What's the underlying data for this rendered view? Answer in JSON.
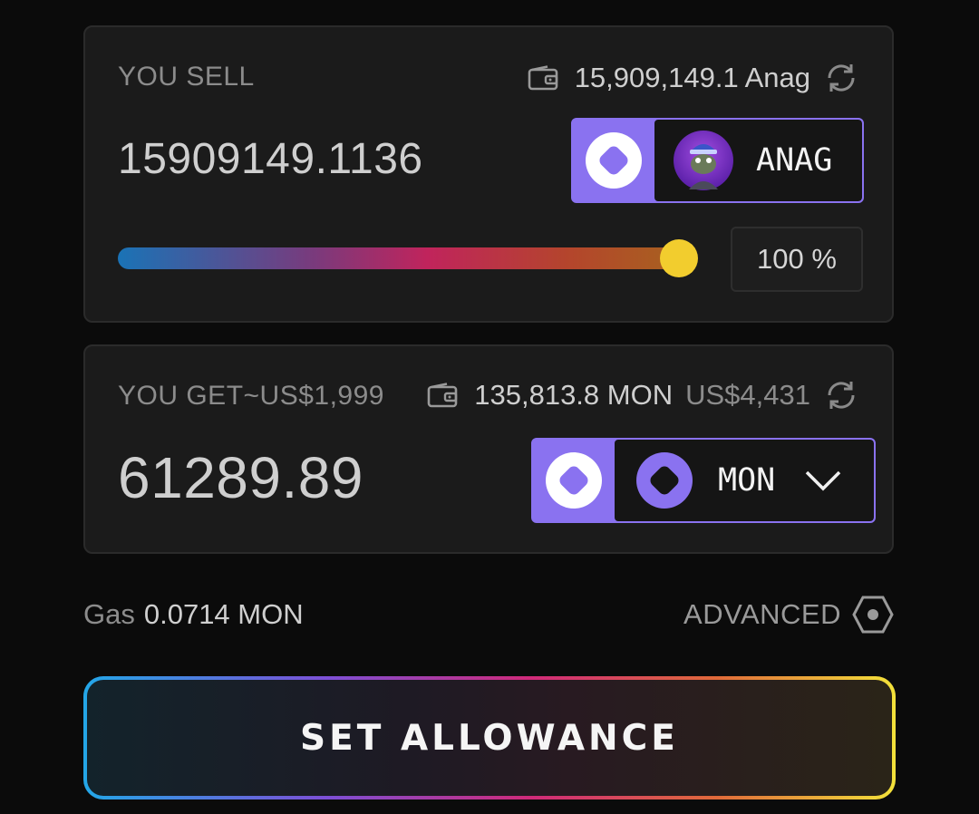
{
  "sell": {
    "label": "YOU SELL",
    "balance": "15,909,149.1 Anag",
    "amount": "15909149.1136",
    "token": "ANAG",
    "percent": "100 %",
    "slider_fraction": 1.0
  },
  "get": {
    "label": "YOU GET",
    "usd_estimate": "~US$1,999",
    "balance": "135,813.8 MON",
    "balance_usd": "US$4,431",
    "amount": "61289.89",
    "token": "MON"
  },
  "gas": {
    "label": "Gas",
    "value": "0.0714 MON"
  },
  "advanced_label": "ADVANCED",
  "cta_label": "SET ALLOWANCE",
  "colors": {
    "accent": "#8a72f0",
    "thumb": "#f2cd2e",
    "panel": "#1b1b1b",
    "background": "#0b0b0b"
  },
  "icons": [
    "wallet-icon",
    "refresh-icon",
    "monad-logo-icon",
    "pepe-avatar-icon",
    "chevron-down-icon",
    "hexagon-settings-icon"
  ]
}
